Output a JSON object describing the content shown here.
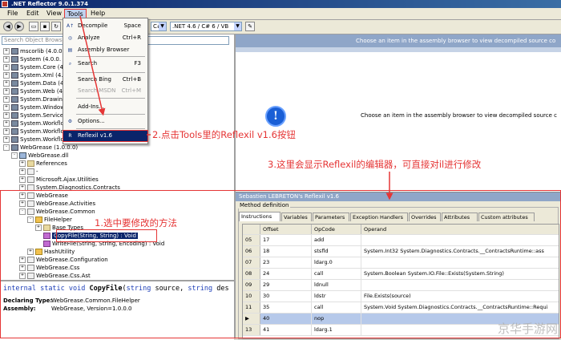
{
  "window": {
    "title": ".NET Reflector 9.0.1.374"
  },
  "menubar": {
    "items": [
      "File",
      "Edit",
      "View",
      "Tools",
      "Help"
    ]
  },
  "toolbar": {
    "framework_label": ".NET 4.6 / C# 6 / VB",
    "language_combo_value": "C#"
  },
  "search": {
    "placeholder": "Search Object Browser"
  },
  "tree": [
    {
      "name": "mscorlib (4.0.0",
      "indent": 0,
      "icon": "assembly",
      "exp": "+"
    },
    {
      "name": "System (4.0.0.",
      "indent": 0,
      "icon": "assembly",
      "exp": "+"
    },
    {
      "name": "System.Core (4.",
      "indent": 0,
      "icon": "assembly",
      "exp": "+"
    },
    {
      "name": "System.Xml (4.0",
      "indent": 0,
      "icon": "assembly",
      "exp": "+"
    },
    {
      "name": "System.Data (4.",
      "indent": 0,
      "icon": "assembly",
      "exp": "+"
    },
    {
      "name": "System.Web (4.0",
      "indent": 0,
      "icon": "assembly",
      "exp": "+"
    },
    {
      "name": "System.Drawing",
      "indent": 0,
      "icon": "assembly",
      "exp": "+"
    },
    {
      "name": "System.Windows",
      "indent": 0,
      "icon": "assembly",
      "exp": "+"
    },
    {
      "name": "System.Service",
      "indent": 0,
      "icon": "assembly",
      "exp": "+"
    },
    {
      "name": "System.Workflo",
      "indent": 0,
      "icon": "assembly",
      "exp": "+"
    },
    {
      "name": "System.Workflo",
      "indent": 0,
      "icon": "assembly",
      "exp": "+"
    },
    {
      "name": "System.Workflo",
      "indent": 0,
      "icon": "assembly",
      "exp": "+"
    },
    {
      "name": "WebGrease (1.0.0.0)",
      "indent": 0,
      "icon": "assembly",
      "exp": "-"
    },
    {
      "name": "WebGrease.dll",
      "indent": 1,
      "icon": "dll",
      "exp": "-"
    },
    {
      "name": "References",
      "indent": 2,
      "icon": "folder",
      "exp": "+"
    },
    {
      "name": "-",
      "indent": 2,
      "icon": "ns",
      "exp": "+"
    },
    {
      "name": "Microsoft.Ajax.Utilities",
      "indent": 2,
      "icon": "ns",
      "exp": "+"
    },
    {
      "name": "System.Diagnostics.Contracts",
      "indent": 2,
      "icon": "ns",
      "exp": "+"
    },
    {
      "name": "WebGrease",
      "indent": 2,
      "icon": "ns",
      "exp": "+"
    },
    {
      "name": "WebGrease.Activities",
      "indent": 2,
      "icon": "ns",
      "exp": "+"
    },
    {
      "name": "WebGrease.Common",
      "indent": 2,
      "icon": "ns",
      "exp": "-"
    },
    {
      "name": "FileHelper",
      "indent": 3,
      "icon": "class",
      "exp": "-"
    },
    {
      "name": "Base Types",
      "indent": 4,
      "icon": "folder",
      "exp": "+"
    },
    {
      "name": "CopyFile(String, String) : Void",
      "indent": 4,
      "icon": "method",
      "exp": "",
      "selected": true
    },
    {
      "name": "WriteFile(String, String, Encoding) : Void",
      "indent": 4,
      "icon": "method",
      "exp": ""
    },
    {
      "name": "HashUtility",
      "indent": 3,
      "icon": "class",
      "exp": "+"
    },
    {
      "name": "WebGrease.Configuration",
      "indent": 2,
      "icon": "ns",
      "exp": "+"
    },
    {
      "name": "WebGrease.Css",
      "indent": 2,
      "icon": "ns",
      "exp": "+"
    },
    {
      "name": "WebGrease.Css.Ast",
      "indent": 2,
      "icon": "ns",
      "exp": "+"
    }
  ],
  "info": {
    "sig_internal": "internal",
    "sig_static": "static",
    "sig_void": "void",
    "sig_name": "CopyFile",
    "sig_open": "(",
    "sig_type1": "string",
    "sig_arg1": " source, ",
    "sig_type2": "string",
    "sig_rest": " des",
    "declaring_label": "Declaring Type:",
    "declaring_value": "WebGrease.Common.FileHelper",
    "assembly_label": "Assembly:",
    "assembly_value": "WebGrease, Version=1.0.0.0"
  },
  "right": {
    "header_text": "Choose an item in the assembly browser to view decompiled source co",
    "message": "Choose an item in the assembly browser to view decompiled source c",
    "info_glyph": "!"
  },
  "tools_menu": {
    "items": [
      {
        "label": "Decompile",
        "shortcut": "Space",
        "icon": "decompile-icon",
        "glyph": "A↑",
        "disabled": false
      },
      {
        "label": "Analyze",
        "shortcut": "Ctrl+R",
        "icon": "analyze-icon",
        "glyph": "◎",
        "disabled": false
      },
      {
        "label": "Assembly Browser",
        "shortcut": "",
        "icon": "assembly-browser-icon",
        "glyph": "▤",
        "disabled": false
      },
      {
        "label": "Search",
        "shortcut": "F3",
        "icon": "search-icon",
        "glyph": "⌕",
        "disabled": false
      },
      {
        "label": "Search Bing",
        "shortcut": "Ctrl+B",
        "icon": "",
        "glyph": "",
        "disabled": false
      },
      {
        "label": "Search MSDN",
        "shortcut": "Ctrl+M",
        "icon": "",
        "glyph": "",
        "disabled": true
      },
      {
        "label": "Add-Ins...",
        "shortcut": "",
        "icon": "",
        "glyph": "",
        "disabled": false
      },
      {
        "label": "Options...",
        "shortcut": "",
        "icon": "options-icon",
        "glyph": "⚙",
        "disabled": false
      },
      {
        "label": "Reflexil v1.6",
        "shortcut": "",
        "icon": "reflexil-icon",
        "glyph": "R",
        "disabled": false,
        "highlighted": true
      }
    ]
  },
  "reflexil": {
    "title": "Sebastien LEBRETON's Reflexil v1.6",
    "section_label": "Method definition",
    "tabs": [
      "Instructions",
      "Variables",
      "Parameters",
      "Exception Handlers",
      "Overrides",
      "Attributes",
      "Custom attributes"
    ],
    "columns": [
      "Offset",
      "OpCode",
      "Operand"
    ],
    "rows": [
      {
        "index": "05",
        "offset": "17",
        "opcode": "add",
        "operand": ""
      },
      {
        "index": "06",
        "offset": "18",
        "opcode": "stsfld",
        "operand": "System.Int32 System.Diagnostics.Contracts.__ContractsRuntime::ass"
      },
      {
        "index": "07",
        "offset": "23",
        "opcode": "ldarg.0",
        "operand": ""
      },
      {
        "index": "08",
        "offset": "24",
        "opcode": "call",
        "operand": "System.Boolean System.IO.File::Exists(System.String)"
      },
      {
        "index": "09",
        "offset": "29",
        "opcode": "ldnull",
        "operand": ""
      },
      {
        "index": "10",
        "offset": "30",
        "opcode": "ldstr",
        "operand": "File.Exists(source)"
      },
      {
        "index": "11",
        "offset": "35",
        "opcode": "call",
        "operand": "System.Void System.Diagnostics.Contracts.__ContractsRuntime::Requi"
      },
      {
        "index": "▶",
        "offset": "40",
        "opcode": "nop",
        "operand": "",
        "selected": true
      },
      {
        "index": "13",
        "offset": "41",
        "opcode": "ldarg.1",
        "operand": ""
      }
    ]
  },
  "annotations": {
    "step1": "1.选中要修改的方法",
    "step2": "2.点击Tools里的Reflexil v1.6按钮",
    "step3": "3.这里会显示Reflexil的编辑器，可直接对il进行修改"
  },
  "watermark": "京华手游网",
  "colors": {
    "accent": "#0a246a",
    "annotation": "#e53535",
    "panel_header": "#8fa6c8"
  }
}
